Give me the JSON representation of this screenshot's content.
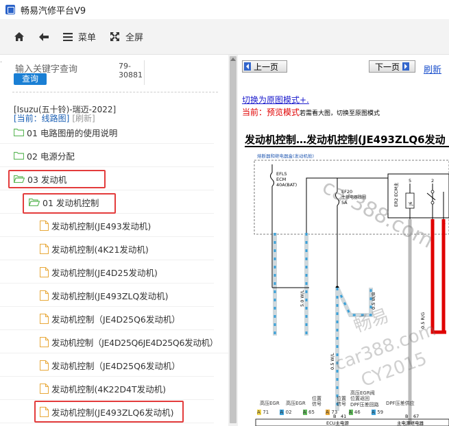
{
  "window": {
    "title": "畅易汽修平台V9"
  },
  "toolbar": {
    "menu_label": "菜单",
    "fullscreen_label": "全屏"
  },
  "search": {
    "placeholder": "输入关键字查询",
    "id_text": "79-30881",
    "button_label": "查询"
  },
  "vehicle": {
    "name": "[Isuzu(五十铃)-瑞迈-2022]",
    "current_label": "[当前：线路图]",
    "refresh_label": "[刷新]"
  },
  "tree": {
    "items": [
      {
        "label": "01 电路图册的使用说明"
      },
      {
        "label": "02 电源分配"
      },
      {
        "label": "03 发动机"
      },
      {
        "label": "01 发动机控制"
      },
      {
        "label": "发动机控制(JE493发动机)"
      },
      {
        "label": "发动机控制(4K21发动机)"
      },
      {
        "label": "发动机控制(JE4D25发动机)"
      },
      {
        "label": "发动机控制(JE493ZLQ发动机)"
      },
      {
        "label": "发动机控制（JE4D25Q6发动机）"
      },
      {
        "label": "发动机控制（JE4D25Q6JE4D25Q6发动机）"
      },
      {
        "label": "发动机控制（JE4D25Q6发动机）"
      },
      {
        "label": "发动机控制(4K22D4T发动机)"
      },
      {
        "label": "发动机控制(JE493ZLQ6发动机)"
      }
    ]
  },
  "viewer": {
    "prev_label": "上一页",
    "next_label": "下一页",
    "refresh_label": "刷新",
    "switch_label": "切换为原图模式+.",
    "current_mode": "当前：预览模式",
    "current_mode_hint": "若需看大图，切换至原图模式",
    "diagram_title": "发动机控制…发动机控制(JE493ZLQ6发动",
    "diagram": {
      "fuse_box_label": "熔断器和继电器盒(发动机舱)",
      "fuse1": [
        "EFL5",
        "ECM",
        "40A(BAT)"
      ],
      "fuse2": [
        "EF20",
        "主继电器线圈",
        "5A"
      ],
      "relay_label": "ER2 ECM主",
      "relay_box": "J6",
      "pins_top": [
        "5",
        "2"
      ],
      "pins_bottom": [
        "3",
        "1",
        "4"
      ],
      "wire1": "5.0 W/L",
      "wire2": "0.5 W/B",
      "wire3": "0.5 R/G",
      "wire4": "0.5 W/L",
      "ecu_label": "ECU主电源",
      "relay_label2": "主电源继电器",
      "ecu_pins": [
        "B",
        "41",
        "B",
        "67"
      ],
      "signals": [
        "高压EGR",
        "高压EGR",
        "位置信号",
        "位置信号",
        "高压EGR阀位置返回",
        "DPF压差回路",
        "DPF压差供应"
      ],
      "bottom_pins": [
        "A",
        "71",
        "A",
        "02",
        "A",
        "65",
        "A",
        "73",
        "A",
        "46",
        "A",
        "59"
      ]
    },
    "watermarks": [
      "car388.com",
      "畅易",
      "car388.com",
      "CY2015"
    ]
  },
  "colors": {
    "accent": "#1a7fd4",
    "highlight": "#e33b3b",
    "folder": "#5fb85a",
    "wire_blue": "#3aa0d8",
    "wire_red": "#e00000"
  }
}
